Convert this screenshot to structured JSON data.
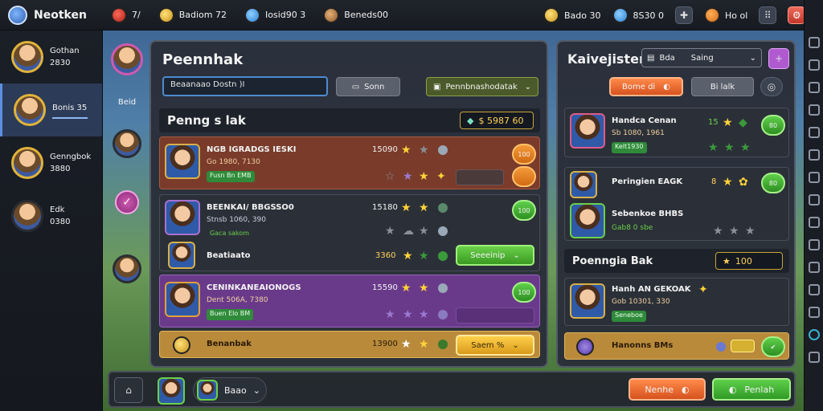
{
  "topbar": {
    "brand": "Neotken",
    "resources": [
      {
        "icon": "ruby-icon",
        "value": "7/"
      },
      {
        "icon": "gold-coin-icon",
        "label": "Badiom 72"
      },
      {
        "icon": "shield-icon",
        "label": "Iosid90 3"
      },
      {
        "icon": "helmet-icon",
        "label": "Beneds00"
      }
    ],
    "right": [
      {
        "icon": "gold-coin-icon",
        "label": "Bado 30"
      },
      {
        "icon": "gear-icon",
        "label": "8S30 0"
      },
      {
        "icon": "wrench-icon",
        "label": "Ho ol"
      }
    ]
  },
  "sidebar": {
    "profiles": [
      {
        "line1": "Gothan",
        "line2": "2830"
      },
      {
        "line1": "Bonis 35",
        "line2": ""
      },
      {
        "line1": "Genngbok",
        "line2": "3880"
      },
      {
        "line1": "Edk",
        "line2": "0380"
      }
    ]
  },
  "midcol": {
    "label": "Beid"
  },
  "left_panel": {
    "title": "Peennhak",
    "search_value": "Beaanaao Dostn )I",
    "sort_label": "Sonn",
    "filter_label": "Pennbnashodatak",
    "subhead": "Penng s lak",
    "subhead_gold": "$ 5987 60",
    "rows": [
      {
        "name": "NGB IGRADGS IESKI",
        "sub": "Go 1980, 7130",
        "tag": "Fusn Bn EMB",
        "num": "15090",
        "btn": "100"
      },
      {
        "name": "BEENKAI/ BBGSSO0",
        "sub": "Stnsb 1060, 390",
        "tag": "Gaca sakom",
        "num": "15180",
        "btn": "100"
      },
      {
        "name": "Beatiaato",
        "num": "3360",
        "btn": "Seeeinip"
      },
      {
        "name": "CENINKANEAIONOGS",
        "sub": "Dent 506A, 7380",
        "tag": "Buen Elo BM",
        "num": "15590",
        "btn": "100"
      },
      {
        "name": "Benanbak",
        "num": "13900",
        "btn": "Saem %"
      }
    ]
  },
  "right_panel": {
    "title": "Kaivejisten",
    "select_label": "Bda",
    "select_value": "Saing",
    "orange_btn": "Bome di",
    "dark_btn": "Bi lalk",
    "rows": [
      {
        "name": "Handca Cenan",
        "sub": "Sb 1080, 1961",
        "tag": "Kelt1930",
        "num": "15",
        "btn": "80"
      },
      {
        "name": "Peringien EAGK",
        "num": "8",
        "btn": "80"
      },
      {
        "name": "Sebenkoe BHBS",
        "tag": "Gab8 0 sbe"
      }
    ],
    "subhead": "Poenngia Bak",
    "subhead_gold": "100",
    "row4": {
      "name": "Hanh AN GEKOAK",
      "sub": "Gob 10301, 330",
      "tag": "Seneboe"
    },
    "row5": {
      "name": "Hanonns BMs"
    }
  },
  "bottombar": {
    "tab_label": "Baao",
    "nenhe_btn": "Nenhe",
    "penlah_btn": "Penlah"
  }
}
